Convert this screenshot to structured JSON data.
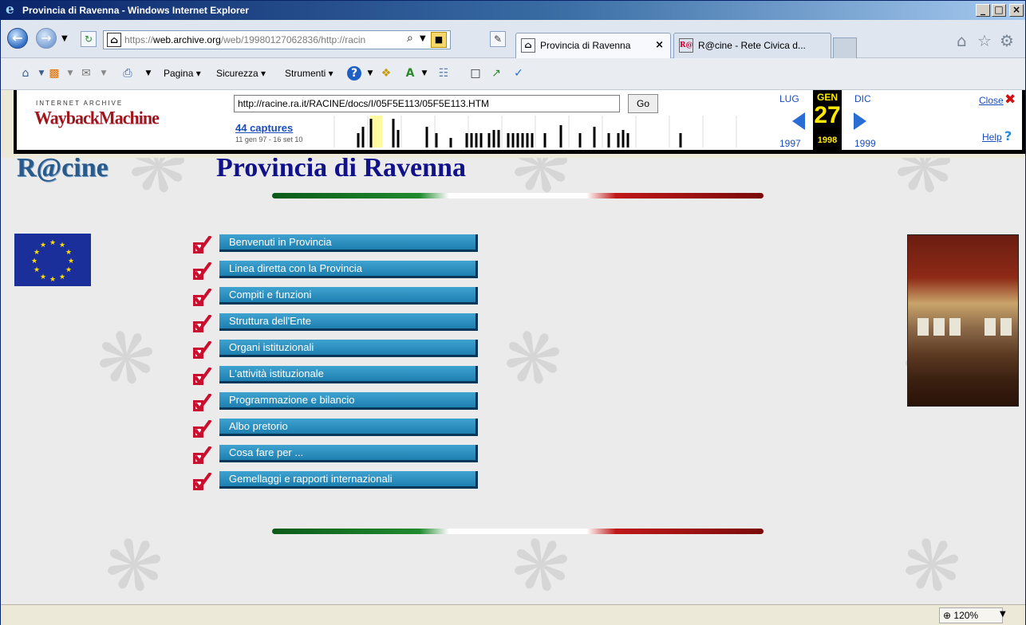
{
  "window": {
    "title": "Provincia di Ravenna - Windows Internet Explorer",
    "min": "_",
    "max": "□",
    "close": "×"
  },
  "addressbar": {
    "url_prefix": "https://",
    "url_host": "web.archive.org",
    "url_rest": "/web/19980127062836/http://racin",
    "search_glyph": "⌕",
    "lock_glyph": "■"
  },
  "tabs": [
    {
      "label": "Provincia di Ravenna",
      "close": "×",
      "active": true
    },
    {
      "label": "R@cine - Rete Civica d...",
      "active": false
    }
  ],
  "commandbar": {
    "page": "Pagina ▾",
    "security": "Sicurezza ▾",
    "tools": "Strumenti ▾",
    "help_glyph": "?"
  },
  "wayback": {
    "logo_top": "INTERNET ARCHIVE",
    "logo": "WaybackMachine",
    "url": "http://racine.ra.it/RACINE/docs/I/05F5E113/05F5E113.HTM",
    "go": "Go",
    "captures": "44 captures",
    "range": "11 gen 97 - 16 set 10",
    "prev_month": "LUG",
    "month": "GEN",
    "next_month": "DIC",
    "day": "27",
    "prev_year": "1997",
    "year": "1998",
    "next_year": "1999",
    "close": "Close",
    "help": "Help",
    "close_glyph": "✖",
    "help_glyph": "?"
  },
  "page": {
    "logo": "R@cine",
    "title": "Provincia di Ravenna",
    "menu": [
      "Benvenuti in Provincia",
      "Linea diretta con la Provincia",
      "Compiti e funzioni",
      "Struttura dell'Ente",
      "Organi istituzionali",
      "L'attività istituzionale",
      "Programmazione e bilancio",
      " Albo pretorio",
      "Cosa fare per ...",
      "Gemellaggi e rapporti internazionali"
    ]
  },
  "statusbar": {
    "zoom": "⊕ 120%",
    "zoom_dropdown": "▼"
  },
  "colors": {
    "menu_button": "#1d7fb0",
    "title": "#11118a",
    "wayback_red": "#a0141e"
  }
}
